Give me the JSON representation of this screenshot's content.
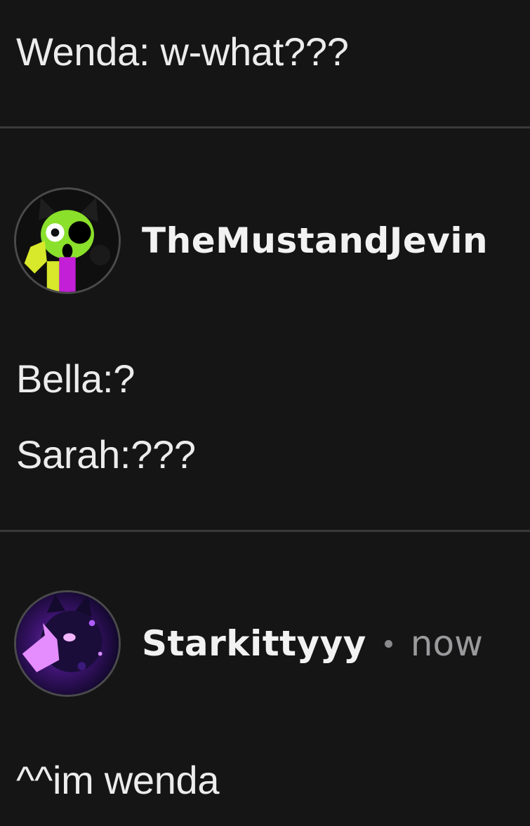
{
  "comments": [
    {
      "lines": [
        "Wenda: w-what???"
      ]
    },
    {
      "author": "TheMustandJevin",
      "avatar_icon": "green-skull-cat-avatar",
      "lines": [
        "Bella:?",
        "Sarah:???"
      ]
    },
    {
      "author": "Starkittyyy",
      "timestamp": "now",
      "avatar_icon": "purple-galaxy-cat-avatar",
      "lines": [
        "^^im wenda"
      ]
    }
  ],
  "colors": {
    "background": "#151516",
    "divider": "#3a3a3c",
    "text": "#ececec",
    "muted": "#9a9a9c"
  }
}
